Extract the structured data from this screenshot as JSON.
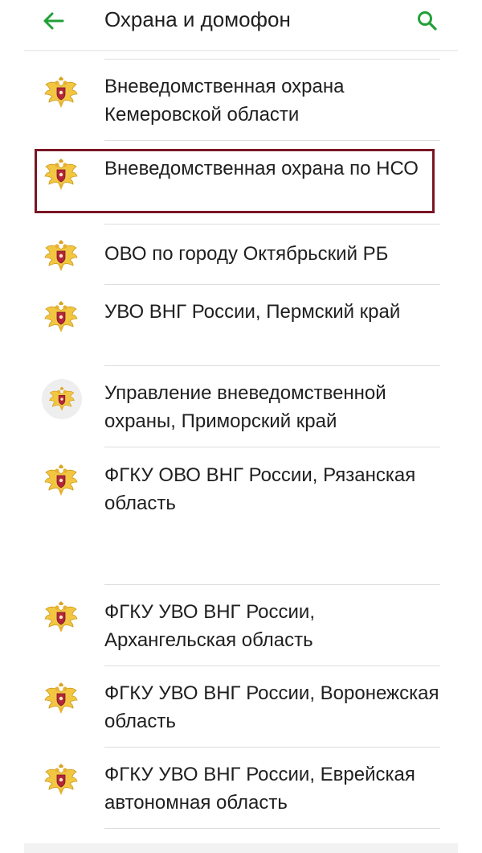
{
  "header": {
    "title": "Охрана и домофон",
    "back_icon": "arrow-left-icon",
    "search_icon": "search-icon",
    "accent_color": "#21a038"
  },
  "list": {
    "items": [
      {
        "label": "Вневедомственная охрана Кемеровской области"
      },
      {
        "label": "Вневедомственная охрана по НСО"
      },
      {
        "label": "ОВО по городу Октябрьский РБ"
      },
      {
        "label": "УВО ВНГ России, Пермский край"
      },
      {
        "label": "Управление вневедомственной охраны, Приморский край"
      },
      {
        "label": "ФГКУ ОВО ВНГ России, Рязанская область"
      },
      {
        "label": "ФГКУ УВО ВНГ России, Архангельская область"
      },
      {
        "label": "ФГКУ УВО ВНГ России, Воронежская область"
      },
      {
        "label": "ФГКУ УВО ВНГ России, Еврейская автономная область"
      }
    ],
    "icon": "rosgvardia-emblem-icon",
    "highlight_color": "#7a1626"
  }
}
